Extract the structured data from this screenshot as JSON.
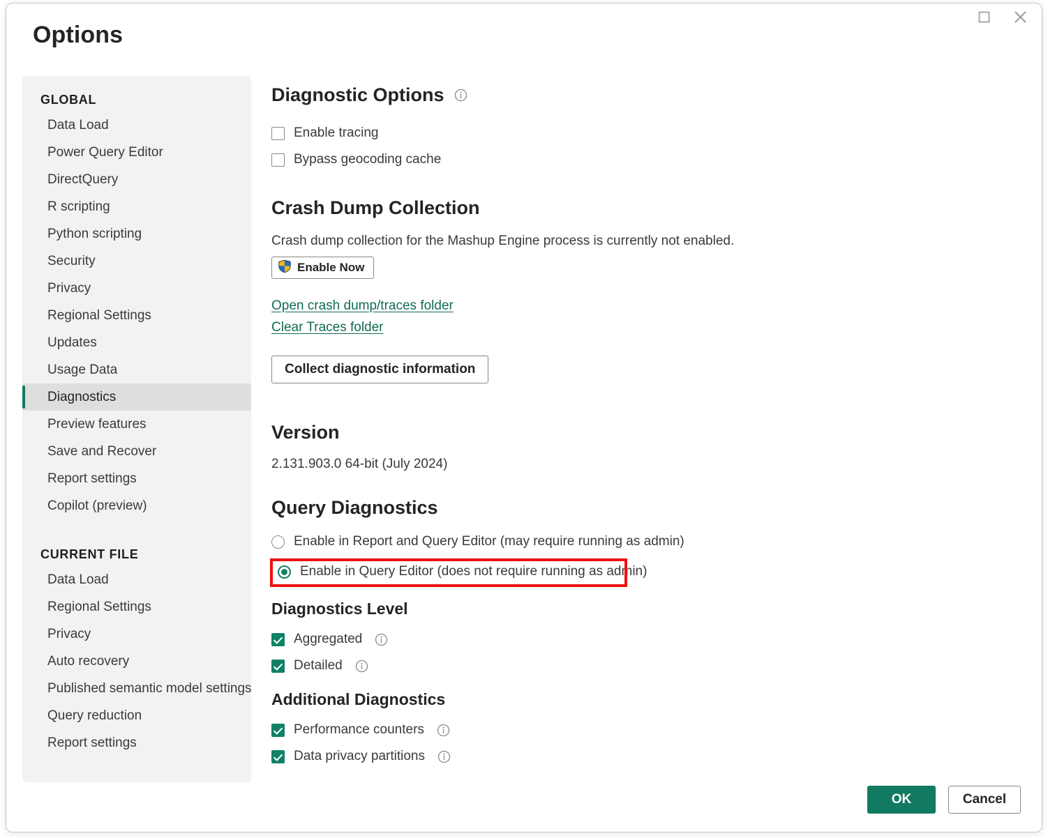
{
  "window": {
    "title": "Options",
    "maximize_icon": "maximize-icon",
    "close_icon": "close-icon"
  },
  "sidebar": {
    "groups": [
      {
        "title": "GLOBAL",
        "items": [
          {
            "label": "Data Load",
            "selected": false
          },
          {
            "label": "Power Query Editor",
            "selected": false
          },
          {
            "label": "DirectQuery",
            "selected": false
          },
          {
            "label": "R scripting",
            "selected": false
          },
          {
            "label": "Python scripting",
            "selected": false
          },
          {
            "label": "Security",
            "selected": false
          },
          {
            "label": "Privacy",
            "selected": false
          },
          {
            "label": "Regional Settings",
            "selected": false
          },
          {
            "label": "Updates",
            "selected": false
          },
          {
            "label": "Usage Data",
            "selected": false
          },
          {
            "label": "Diagnostics",
            "selected": true
          },
          {
            "label": "Preview features",
            "selected": false
          },
          {
            "label": "Save and Recover",
            "selected": false
          },
          {
            "label": "Report settings",
            "selected": false
          },
          {
            "label": "Copilot (preview)",
            "selected": false
          }
        ]
      },
      {
        "title": "CURRENT FILE",
        "items": [
          {
            "label": "Data Load",
            "selected": false
          },
          {
            "label": "Regional Settings",
            "selected": false
          },
          {
            "label": "Privacy",
            "selected": false
          },
          {
            "label": "Auto recovery",
            "selected": false
          },
          {
            "label": "Published semantic model settings",
            "selected": false
          },
          {
            "label": "Query reduction",
            "selected": false
          },
          {
            "label": "Report settings",
            "selected": false
          }
        ]
      }
    ]
  },
  "main": {
    "diagnostic_options": {
      "heading": "Diagnostic Options",
      "info_icon": "info-icon",
      "checkboxes": [
        {
          "label": "Enable tracing",
          "checked": false
        },
        {
          "label": "Bypass geocoding cache",
          "checked": false
        }
      ]
    },
    "crash_dump": {
      "heading": "Crash Dump Collection",
      "description": "Crash dump collection for the Mashup Engine process is currently not enabled.",
      "enable_now_label": "Enable Now",
      "enable_now_icon": "uac-shield-icon",
      "links": [
        "Open crash dump/traces folder",
        "Clear Traces folder"
      ],
      "collect_button_label": "Collect diagnostic information"
    },
    "version": {
      "heading": "Version",
      "value": "2.131.903.0 64-bit (July 2024)"
    },
    "query_diagnostics": {
      "heading": "Query Diagnostics",
      "radios": [
        {
          "label": "Enable in Report and Query Editor (may require running as admin)",
          "selected": false
        },
        {
          "label": "Enable in Query Editor (does not require running as admin)",
          "selected": true,
          "highlighted": true
        }
      ]
    },
    "diagnostics_level": {
      "heading": "Diagnostics Level",
      "checkboxes": [
        {
          "label": "Aggregated",
          "checked": true,
          "info_icon": "info-icon"
        },
        {
          "label": "Detailed",
          "checked": true,
          "info_icon": "info-icon"
        }
      ]
    },
    "additional_diagnostics": {
      "heading": "Additional Diagnostics",
      "checkboxes": [
        {
          "label": "Performance counters",
          "checked": true,
          "info_icon": "info-icon"
        },
        {
          "label": "Data privacy partitions",
          "checked": true,
          "info_icon": "info-icon"
        }
      ]
    }
  },
  "footer": {
    "ok_label": "OK",
    "cancel_label": "Cancel"
  },
  "colors": {
    "accent": "#117a60",
    "link": "#116b55",
    "annotation": "#ee1111",
    "sidebar_bg": "#f3f2f1",
    "selected_item_bg": "#dededc"
  }
}
